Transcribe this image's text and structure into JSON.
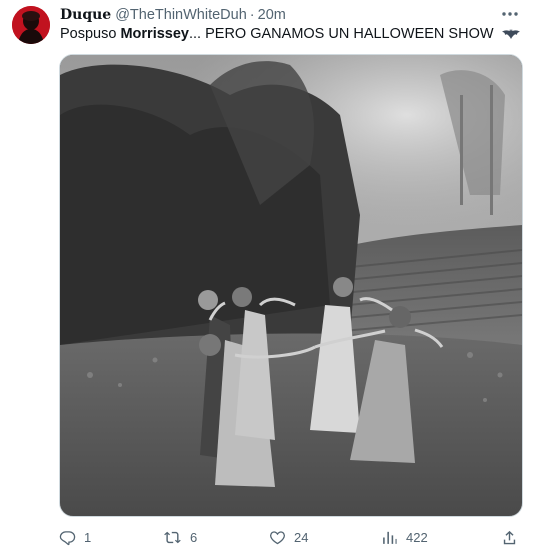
{
  "author": {
    "display_name": "Duque",
    "handle": "@TheThinWhiteDuh",
    "separator": "·",
    "time": "20m"
  },
  "tweet": {
    "text_before": "Pospuso ",
    "text_bold": "Morrissey",
    "text_after": "... PERO GANAMOS UN HALLOWEEN SHOW",
    "emoji": "bat-emoji"
  },
  "media": {
    "icon": "photo",
    "kind": "vintage black-and-white photograph"
  },
  "actions": {
    "reply": {
      "icon": "reply-icon",
      "count": "1"
    },
    "retweet": {
      "icon": "retweet-icon",
      "count": "6"
    },
    "like": {
      "icon": "heart-icon",
      "count": "24"
    },
    "views": {
      "icon": "analytics-icon",
      "count": "422"
    },
    "share": {
      "icon": "share-icon"
    }
  },
  "colors": {
    "text": "#0f1419",
    "secondary": "#536471",
    "avatar_bg": "#c1121f"
  }
}
